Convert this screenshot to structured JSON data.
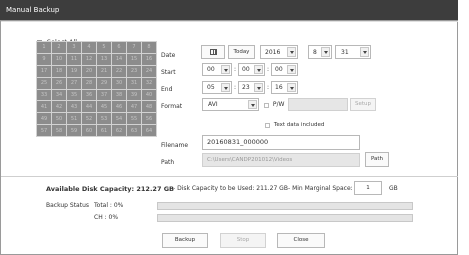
{
  "window": {
    "title": "Manual Backup"
  },
  "select_all": {
    "label": "Select All"
  },
  "channels": [
    "1",
    "2",
    "3",
    "4",
    "5",
    "6",
    "7",
    "8",
    "9",
    "10",
    "11",
    "12",
    "13",
    "14",
    "15",
    "16",
    "17",
    "18",
    "19",
    "20",
    "21",
    "22",
    "23",
    "24",
    "25",
    "26",
    "27",
    "28",
    "29",
    "30",
    "31",
    "32",
    "33",
    "34",
    "35",
    "36",
    "37",
    "38",
    "39",
    "40",
    "41",
    "42",
    "43",
    "44",
    "45",
    "46",
    "47",
    "48",
    "49",
    "50",
    "51",
    "52",
    "53",
    "54",
    "55",
    "56",
    "57",
    "58",
    "59",
    "60",
    "61",
    "62",
    "63",
    "64"
  ],
  "date": {
    "label": "Date",
    "today_label": "Today",
    "year": "2016",
    "month": "8",
    "day": "31"
  },
  "start": {
    "label": "Start",
    "hour": "00",
    "minute": "00",
    "second": "00"
  },
  "end": {
    "label": "End",
    "hour": "05",
    "minute": "23",
    "second": "16"
  },
  "format": {
    "label": "Format",
    "value": "AVI",
    "pw_label": "P/W",
    "setup_label": "Setup",
    "text_data_label": "Text data included"
  },
  "filename": {
    "label": "Filename",
    "value": "20160831_000000"
  },
  "path": {
    "label": "Path",
    "value": "C:\\Users\\CANDP201012\\Videos",
    "button_label": "Path"
  },
  "capacity": {
    "available": "Available Disk Capacity: 212.27 GB",
    "to_be_used": "- Disk Capacity to be Used: 211.27 GB",
    "min_margin_label": "- Min Marginal Space:",
    "min_margin_value": "1",
    "unit": "GB"
  },
  "status": {
    "label": "Backup Status",
    "total": "Total : 0%",
    "ch": "CH : 0%",
    "total_progress": 0,
    "ch_progress": 0
  },
  "buttons": {
    "backup": "Backup",
    "stop": "Stop",
    "close": "Close"
  }
}
